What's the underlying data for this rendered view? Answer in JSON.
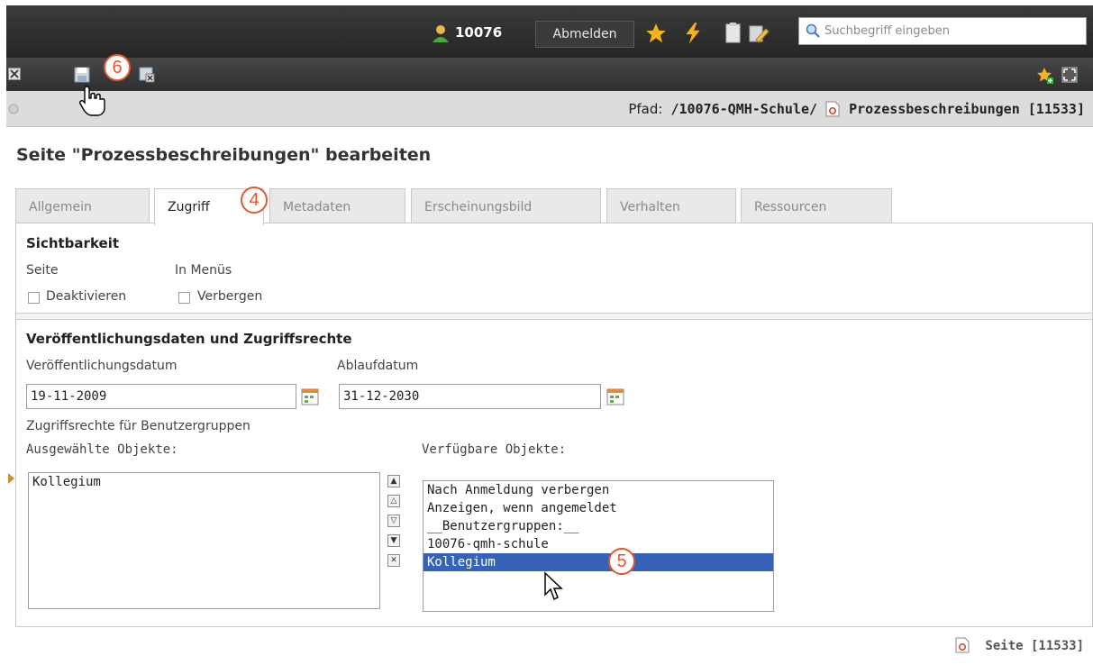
{
  "header": {
    "user_id": "10076",
    "logout_label": "Abmelden",
    "search_placeholder": "Suchbegriff eingeben"
  },
  "toolbar": {
    "callout_6": "6"
  },
  "pathbar": {
    "label": "Pfad:",
    "path_prefix": "/10076-QMH-Schule/",
    "path_page": "Prozessbeschreibungen [11533]"
  },
  "page": {
    "title": "Seite \"Prozessbeschreibungen\" bearbeiten"
  },
  "tabs": [
    {
      "label": "Allgemein",
      "active": false
    },
    {
      "label": "Zugriff",
      "active": true
    },
    {
      "label": "Metadaten",
      "active": false
    },
    {
      "label": "Erscheinungsbild",
      "active": false
    },
    {
      "label": "Verhalten",
      "active": false
    },
    {
      "label": "Ressourcen",
      "active": false
    }
  ],
  "callouts": {
    "c4": "4",
    "c5": "5"
  },
  "visibility": {
    "heading": "Sichtbarkeit",
    "col_page": "Seite",
    "col_menus": "In Menüs",
    "deactivate_label": "Deaktivieren",
    "hide_label": "Verbergen"
  },
  "publishing": {
    "heading": "Veröffentlichungsdaten und Zugriffsrechte",
    "pub_date_label": "Veröffentlichungsdatum",
    "pub_date_value": "19-11-2009",
    "exp_date_label": "Ablaufdatum",
    "exp_date_value": "31-12-2030",
    "rights_label": "Zugriffsrechte für Benutzergruppen",
    "selected_label": "Ausgewählte Objekte:",
    "available_label": "Verfügbare Objekte:",
    "selected_items": [
      "Kollegium"
    ],
    "available_items": [
      {
        "label": "Nach Anmeldung verbergen",
        "selected": false
      },
      {
        "label": "Anzeigen, wenn angemeldet",
        "selected": false
      },
      {
        "label": "__Benutzergruppen:__",
        "selected": false
      },
      {
        "label": "10076-qmh-schule",
        "selected": false
      },
      {
        "label": "Kollegium",
        "selected": true
      }
    ]
  },
  "footer": {
    "page_ref": "Seite [11533]"
  },
  "colors": {
    "accent_callout": "#e8572a",
    "selection": "#3563b7",
    "header_bg": "#2b2b2b"
  }
}
